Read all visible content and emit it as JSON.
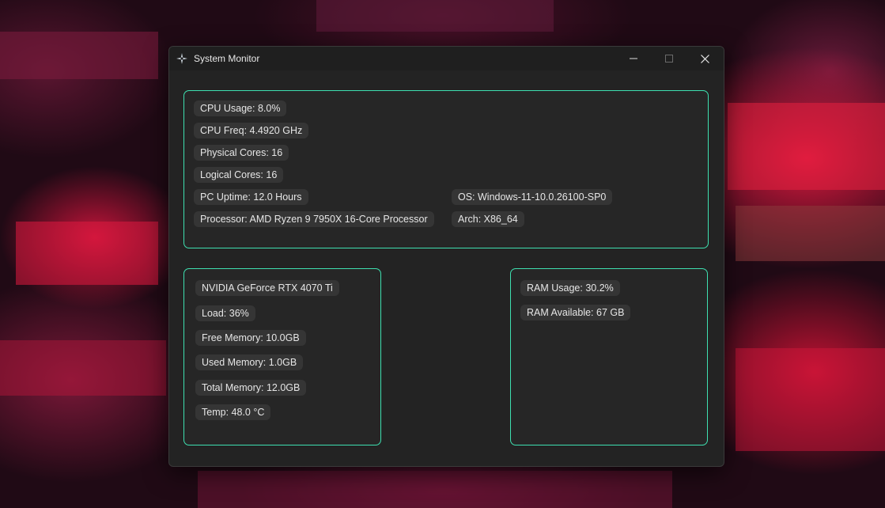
{
  "window": {
    "title": "System Monitor",
    "icon": "fan-icon"
  },
  "controls": {
    "minimize_icon": "minimize-icon",
    "maximize_icon": "maximize-icon",
    "close_icon": "close-icon"
  },
  "cpu": {
    "usage": "CPU Usage: 8.0%",
    "freq": "CPU Freq: 4.4920 GHz",
    "physical_cores": "Physical Cores: 16",
    "logical_cores": "Logical Cores: 16",
    "uptime": "PC Uptime: 12.0 Hours",
    "processor": "Processor: AMD Ryzen 9 7950X 16-Core Processor",
    "os": "OS: Windows-11-10.0.26100-SP0",
    "arch": "Arch: X86_64"
  },
  "gpu": {
    "name": "NVIDIA GeForce RTX 4070 Ti",
    "load": "Load: 36%",
    "free_memory": "Free Memory: 10.0GB",
    "used_memory": "Used Memory: 1.0GB",
    "total_memory": "Total Memory: 12.0GB",
    "temp": "Temp: 48.0 °C"
  },
  "ram": {
    "usage": "RAM Usage: 30.2%",
    "available": "RAM Available: 67 GB"
  },
  "colors": {
    "accent_border": "#3ee0b0",
    "window_bg": "#232323",
    "chip_bg": "#353535"
  }
}
